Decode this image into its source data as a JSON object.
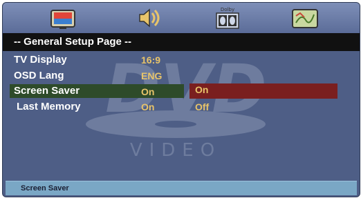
{
  "header": {
    "title": "-- General Setup Page --"
  },
  "icons": [
    "general-setup-icon",
    "audio-setup-icon",
    "dolby-digital-icon",
    "preference-icon"
  ],
  "dolby_icon_text": "Dolby",
  "watermark": {
    "logo": "DVD",
    "text": "VIDEO"
  },
  "settings": [
    {
      "label": "TV Display",
      "value": "16:9"
    },
    {
      "label": "OSD Lang",
      "value": "ENG"
    },
    {
      "label": "Screen Saver",
      "value": "On"
    },
    {
      "label": "Last Memory",
      "value": "On"
    }
  ],
  "submenu": {
    "options": [
      "On",
      "Off"
    ],
    "selected_index": 0
  },
  "status": {
    "text": "Screen Saver"
  },
  "colors": {
    "background": "#4e5e86",
    "header": "#111111",
    "value_text": "#e8c46a",
    "row_highlight": "#2e4b2a",
    "submenu_highlight": "#7a1f1f",
    "status_bar": "#7aa7c5"
  }
}
